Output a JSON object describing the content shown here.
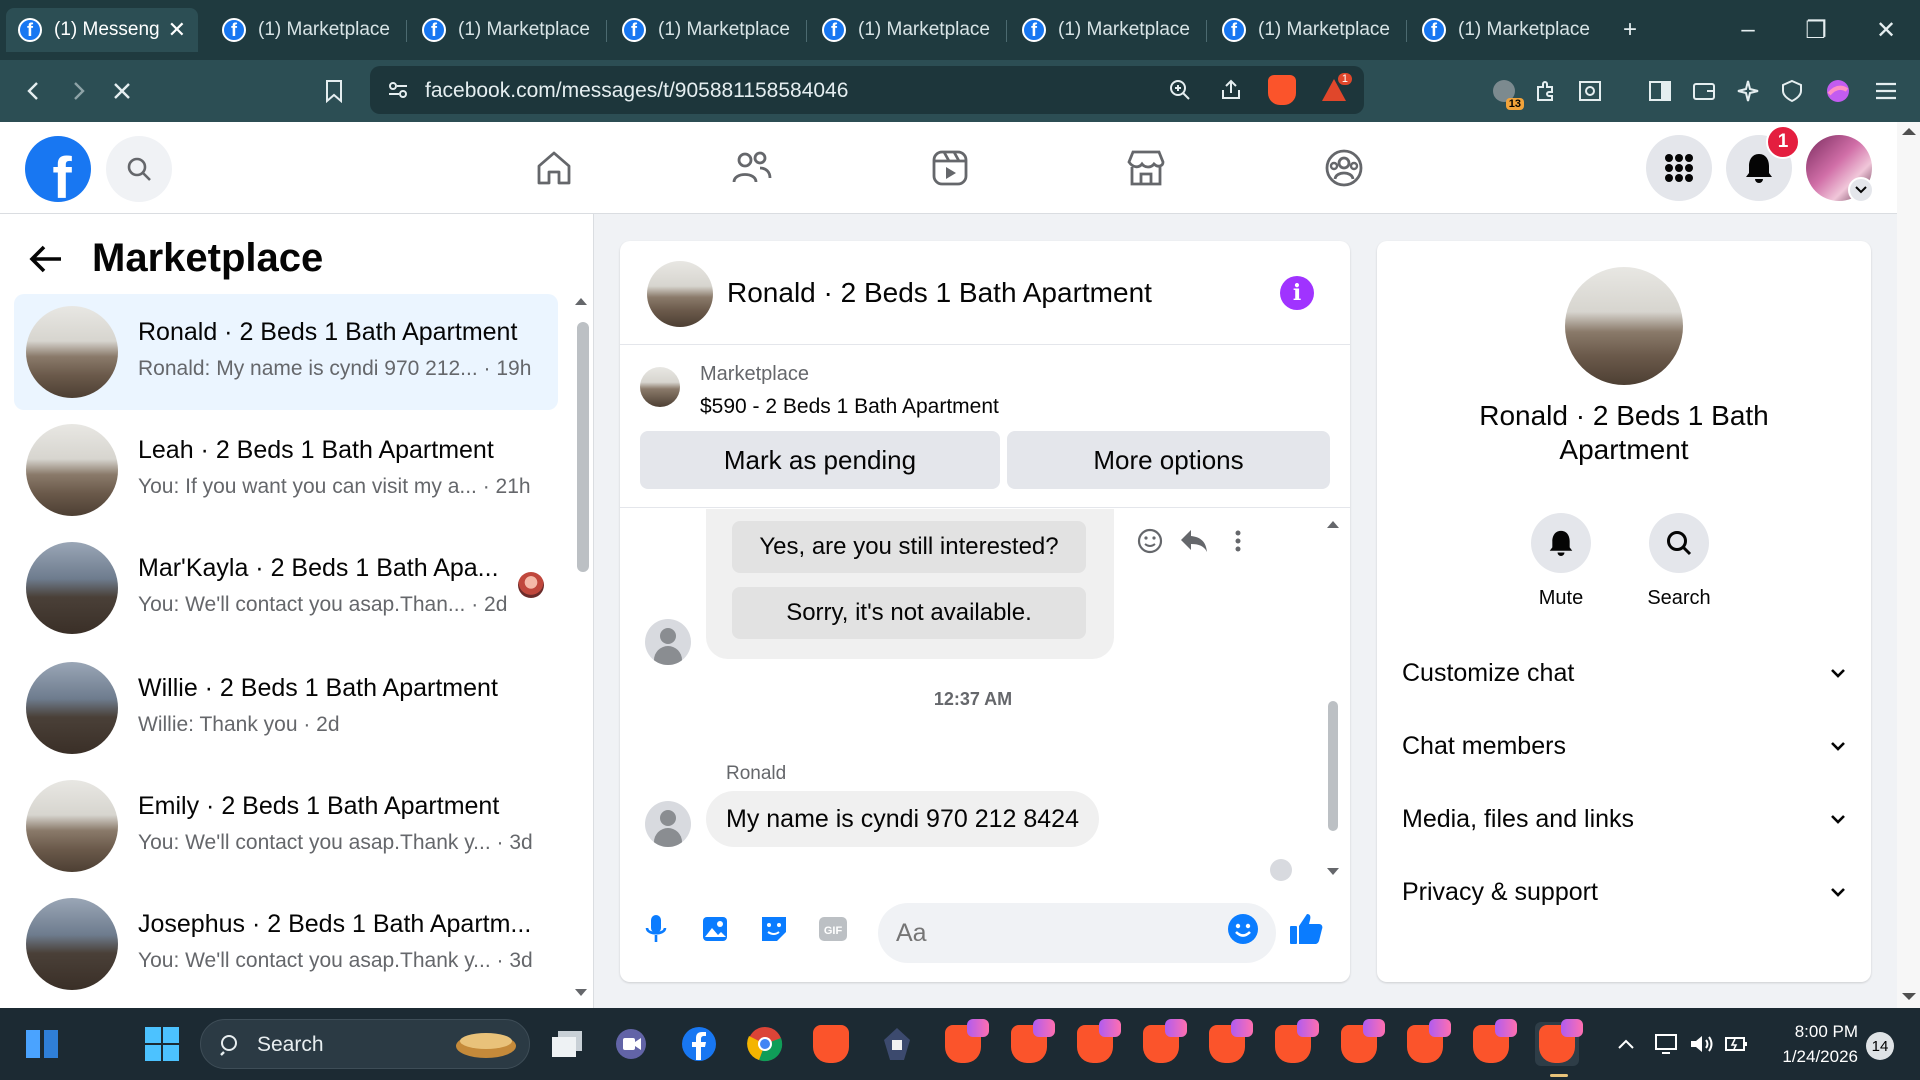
{
  "browser": {
    "tabs": [
      {
        "label": "(1) Messeng",
        "active": true
      },
      {
        "label": "(1) Marketplace"
      },
      {
        "label": "(1) Marketplace"
      },
      {
        "label": "(1) Marketplace"
      },
      {
        "label": "(1) Marketplace"
      },
      {
        "label": "(1) Marketplace"
      },
      {
        "label": "(1) Marketplace"
      },
      {
        "label": "(1) Marketplace"
      }
    ],
    "url": "facebook.com/messages/t/905881158584046",
    "brave_alert_count": "1",
    "extension_count": "13"
  },
  "facebook": {
    "notification_count": "1"
  },
  "left": {
    "title": "Marketplace",
    "conversations": [
      {
        "name": "Ronald · 2 Beds 1 Bath Apartment",
        "preview": "Ronald: My name is cyndi 970 212... · 19h",
        "selected": true
      },
      {
        "name": "Leah · 2 Beds 1 Bath Apartment",
        "preview": "You: If you want you can visit my a... · 21h"
      },
      {
        "name": "Mar'Kayla · 2 Beds 1 Bath Apa...",
        "preview": "You: We'll contact you asap.Than... · 2d"
      },
      {
        "name": "Willie · 2 Beds 1 Bath Apartment",
        "preview": "Willie: Thank you · 2d"
      },
      {
        "name": "Emily · 2 Beds 1 Bath Apartment",
        "preview": "You: We'll contact you asap.Thank y... · 3d"
      },
      {
        "name": "Josephus · 2 Beds 1 Bath Apartm...",
        "preview": "You: We'll contact you asap.Thank y... · 3d"
      }
    ]
  },
  "chat": {
    "title": "Ronald · 2 Beds 1 Bath Apartment",
    "listing": {
      "category": "Marketplace",
      "title": "$590 - 2 Beds 1 Bath Apartment",
      "mark_pending": "Mark as pending",
      "more_options": "More options"
    },
    "quick_replies": [
      "Yes, are you still interested?",
      "Sorry, it's not available."
    ],
    "timestamp": "12:37 AM",
    "sender": "Ronald",
    "message": "My name is cyndi 970 212 8424",
    "composer_placeholder": "Aa"
  },
  "right": {
    "name": "Ronald · 2 Beds 1 Bath Apartment",
    "mute_label": "Mute",
    "search_label": "Search",
    "sections": [
      "Customize chat",
      "Chat members",
      "Media, files and links",
      "Privacy & support"
    ]
  },
  "taskbar": {
    "search_label": "Search",
    "time": "8:00 PM",
    "date": "1/24/2026",
    "notification_count": "14"
  }
}
